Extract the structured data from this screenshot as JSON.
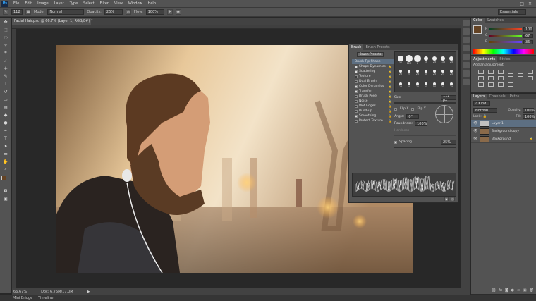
{
  "menubar": {
    "logo": "Ps",
    "items": [
      "File",
      "Edit",
      "Image",
      "Layer",
      "Type",
      "Select",
      "Filter",
      "View",
      "Window",
      "Help"
    ],
    "controls": [
      "–",
      "□",
      "✕"
    ]
  },
  "options": {
    "size": "112",
    "mode_label": "Mode:",
    "mode_value": "Normal",
    "opacity_label": "Opacity:",
    "opacity_value": "26%",
    "flow_label": "Flow:",
    "flow_value": "100%",
    "workspace": "Essentials"
  },
  "document": {
    "tab_title": "Facial Hair.psd @ 66.7% (Layer 1, RGB/8#) *",
    "zoom": "66.67%",
    "doc_info": "Doc: 6.75M/17.0M"
  },
  "bottom_tabs": [
    "Mini Bridge",
    "Timeline"
  ],
  "brush_panel": {
    "tabs": [
      "Brush",
      "Brush Presets"
    ],
    "presets_button": "Brush Presets",
    "options": [
      {
        "label": "Brush Tip Shape",
        "checked": false,
        "highlighted": true
      },
      {
        "label": "Shape Dynamics",
        "checked": true
      },
      {
        "label": "Scattering",
        "checked": true
      },
      {
        "label": "Texture",
        "checked": false
      },
      {
        "label": "Dual Brush",
        "checked": false
      },
      {
        "label": "Color Dynamics",
        "checked": true
      },
      {
        "label": "Transfer",
        "checked": true
      },
      {
        "label": "Brush Pose",
        "checked": false
      },
      {
        "label": "Noise",
        "checked": false
      },
      {
        "label": "Wet Edges",
        "checked": false
      },
      {
        "label": "Build-up",
        "checked": false
      },
      {
        "label": "Smoothing",
        "checked": true
      },
      {
        "label": "Protect Texture",
        "checked": false
      }
    ],
    "brush_sizes": [
      "30",
      "123",
      "8",
      "10",
      "25",
      "112",
      "25",
      "25",
      "25",
      "25",
      "50",
      "25",
      "25",
      "25",
      "25",
      "50",
      "71",
      "25",
      "50",
      "25",
      "25"
    ],
    "size_label": "Size",
    "size_value": "112 px",
    "flip_x": "Flip X",
    "flip_y": "Flip Y",
    "angle_label": "Angle:",
    "angle_value": "0°",
    "roundness_label": "Roundness:",
    "roundness_value": "100%",
    "hardness_label": "Hardness",
    "spacing_label": "Spacing",
    "spacing_value": "25%"
  },
  "color_panel": {
    "tabs": [
      "Color",
      "Swatches"
    ],
    "r_label": "R",
    "r_value": "100",
    "g_label": "G",
    "g_value": "67",
    "b_label": "B",
    "b_value": "36",
    "swatch_color": "#644324"
  },
  "adjustments_panel": {
    "tabs": [
      "Adjustments",
      "Styles"
    ],
    "hint": "Add an adjustment"
  },
  "layers_panel": {
    "tabs": [
      "Layers",
      "Channels",
      "Paths"
    ],
    "kind_label": "Kind",
    "blend_mode": "Normal",
    "opacity_label": "Opacity:",
    "opacity_value": "100%",
    "lock_label": "Lock:",
    "fill_label": "Fill:",
    "fill_value": "100%",
    "layers": [
      {
        "name": "Layer 1",
        "selected": true
      },
      {
        "name": "Background copy",
        "selected": false
      },
      {
        "name": "Background",
        "selected": false
      }
    ]
  }
}
